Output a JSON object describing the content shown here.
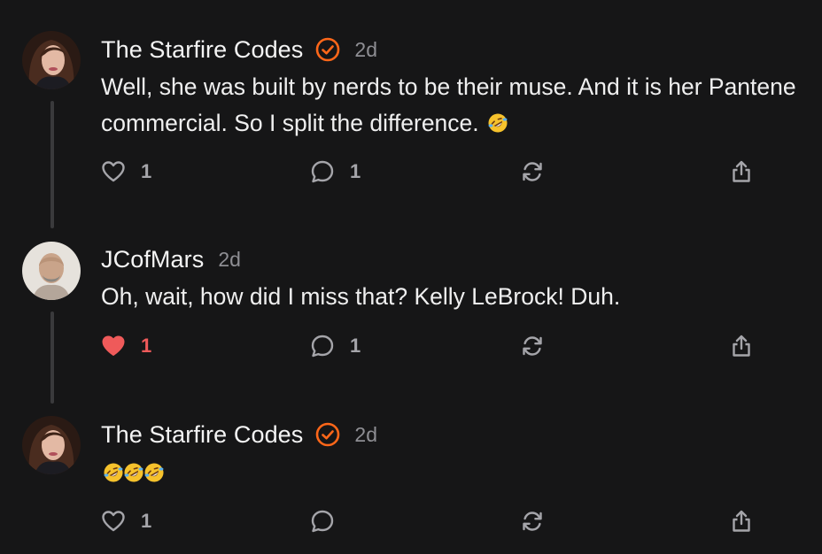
{
  "comments": [
    {
      "author": "The Starfire Codes",
      "verified": true,
      "time": "2d",
      "lines": [
        "Well, she was built by nerds to be their muse. And it is her Pantene",
        "commercial. So I split the difference."
      ],
      "emoji_count": 1,
      "emoji": "rolling-on-floor-laughing",
      "likes": "1",
      "liked": false,
      "replies": "1"
    },
    {
      "author": "JCofMars",
      "verified": false,
      "time": "2d",
      "lines": [
        "Oh, wait, how did I miss that? Kelly LeBrock! Duh."
      ],
      "emoji_count": 0,
      "likes": "1",
      "liked": true,
      "replies": "1"
    },
    {
      "author": "The Starfire Codes",
      "verified": true,
      "time": "2d",
      "lines": [],
      "emoji_count": 3,
      "emoji": "rolling-on-floor-laughing",
      "likes": "1",
      "liked": false,
      "replies": ""
    }
  ],
  "icons": {
    "like": "heart-icon",
    "reply": "comment-bubble-icon",
    "restack": "restack-icon",
    "share": "share-icon",
    "verified": "verified-check-icon"
  },
  "colors": {
    "background": "#161617",
    "accent": "#ff6719",
    "liked": "#ef5a5a",
    "muted": "#8e8e93"
  }
}
